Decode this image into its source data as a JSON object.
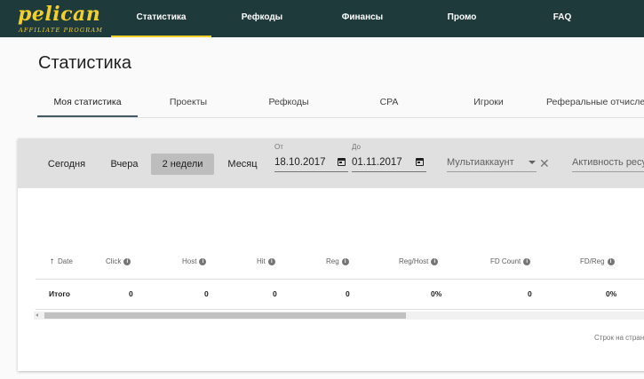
{
  "header": {
    "logo_main": "pelican",
    "logo_sub": "AFFILIATE PROGRAM",
    "nav": [
      "Статистика",
      "Рефкоды",
      "Финансы",
      "Промо",
      "FAQ"
    ],
    "accent_color": "#f3cf2a",
    "bar_color": "#1f3a3b"
  },
  "page": {
    "title": "Статистика",
    "tabs": [
      "Моя статистика",
      "Проекты",
      "Рефкоды",
      "CPA",
      "Игроки",
      "Реферальные отчисления"
    ]
  },
  "filters": {
    "periods": [
      "Сегодня",
      "Вчера",
      "2 недели",
      "Месяц"
    ],
    "active_period": "2 недели",
    "from_label": "От",
    "from_value": "18.10.2017",
    "to_label": "До",
    "to_value": "01.11.2017",
    "multiaccount_placeholder": "Мультиаккаунт",
    "activity_placeholder": "Активность ресурсов"
  },
  "table": {
    "columns": [
      "Date",
      "Click",
      "Host",
      "Hit",
      "Reg",
      "Reg/Host",
      "FD Count",
      "FD/Reg"
    ],
    "total_row": [
      "Итого",
      "0",
      "0",
      "0",
      "0",
      "0%",
      "0",
      "0%"
    ],
    "footer": "Строк на странице"
  }
}
